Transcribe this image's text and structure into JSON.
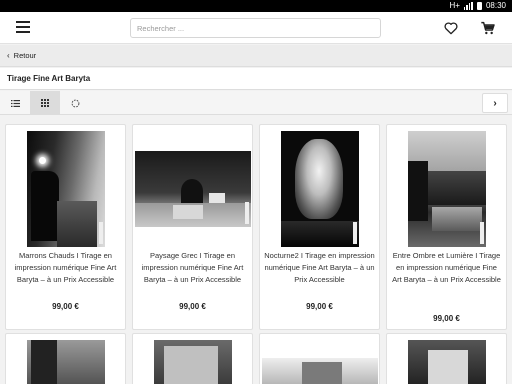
{
  "status_bar": {
    "network": "H+",
    "time": "08:30"
  },
  "header": {
    "search_placeholder": "Rechercher ...",
    "icons": [
      "hamburger-menu-icon",
      "heart-icon",
      "cart-icon"
    ]
  },
  "navigation": {
    "back_label": "Retour"
  },
  "category": {
    "title": "Tirage Fine Art Baryta"
  },
  "toolbar": {
    "icons": [
      "list-view-icon",
      "grid-view-icon",
      "loading-icon",
      "chevron-right-icon"
    ]
  },
  "products": [
    {
      "title": "Marrons Chauds I Tirage en impression numérique Fine Art Baryta – à un Prix Accessible",
      "price": "99,00 €"
    },
    {
      "title": "Paysage Grec I Tirage en impression numérique Fine Art Baryta – à un Prix Accessible",
      "price": "99,00 €"
    },
    {
      "title": "Nocturne2 I Tirage en impression numérique Fine Art Baryta – à un Prix Accessible",
      "price": "99,00 €"
    },
    {
      "title": "Entre Ombre et Lumière I Tirage en impression numérique Fine Art Baryta – à un Prix Accessible",
      "price": "99,00 €"
    }
  ]
}
